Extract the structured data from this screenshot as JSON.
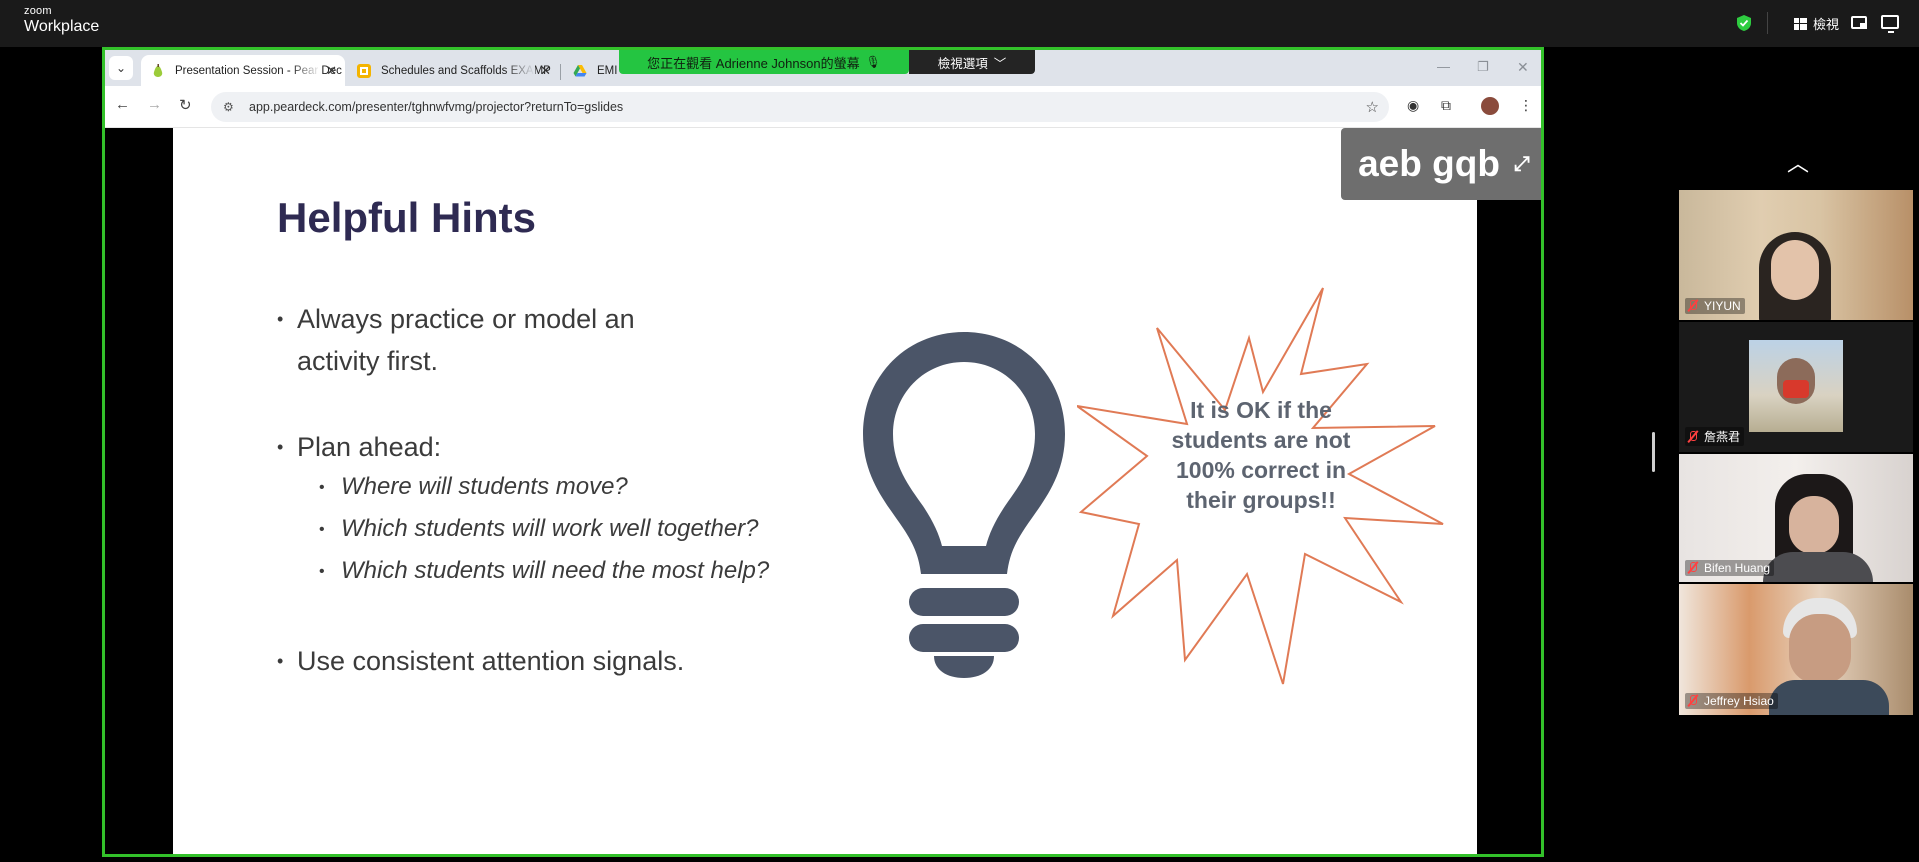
{
  "zoom": {
    "logo_line1": "zoom",
    "logo_line2": "Workplace",
    "view_label": "檢視",
    "icons": [
      "shield-check-icon",
      "grid-view-icon",
      "picture-in-picture-icon",
      "screen-icon"
    ]
  },
  "share": {
    "banner": "您正在觀看 Adrienne Johnson的螢幕",
    "view_options": "檢視選項",
    "border_color": "#33c12a"
  },
  "browser": {
    "tabs": [
      {
        "title": "Presentation Session - Pear Dec",
        "active": true,
        "icon": "pear-deck-icon"
      },
      {
        "title": "Schedules and Scaffolds EXAMP",
        "active": false,
        "icon": "google-slides-icon"
      },
      {
        "title": "EMI",
        "active": false,
        "icon": "google-drive-icon"
      }
    ],
    "url": "app.peardeck.com/presenter/tghnwfvmg/projector?returnTo=gslides"
  },
  "slide": {
    "title": "Helpful Hints",
    "bullets": [
      {
        "line1": "Always practice or model an",
        "line2": "activity first."
      },
      {
        "line1": "Plan ahead:"
      },
      {
        "line1": "Use consistent attention signals."
      }
    ],
    "sub_bullets": [
      "Where will students move?",
      "Which students will work well together?",
      "Which students will need the most help?"
    ],
    "callout": "It is OK if the students are not 100% correct in their groups!!",
    "join_code": "aeb gqb",
    "colors": {
      "title": "#2e2a52",
      "bulb": "#4b5568",
      "starburst": "#e07a55"
    }
  },
  "participants": [
    {
      "name": "YIYUN",
      "muted": true
    },
    {
      "name": "詹燕君",
      "muted": true
    },
    {
      "name": "Bifen Huang",
      "muted": true
    },
    {
      "name": "Jeffrey Hsiao",
      "muted": true
    }
  ]
}
